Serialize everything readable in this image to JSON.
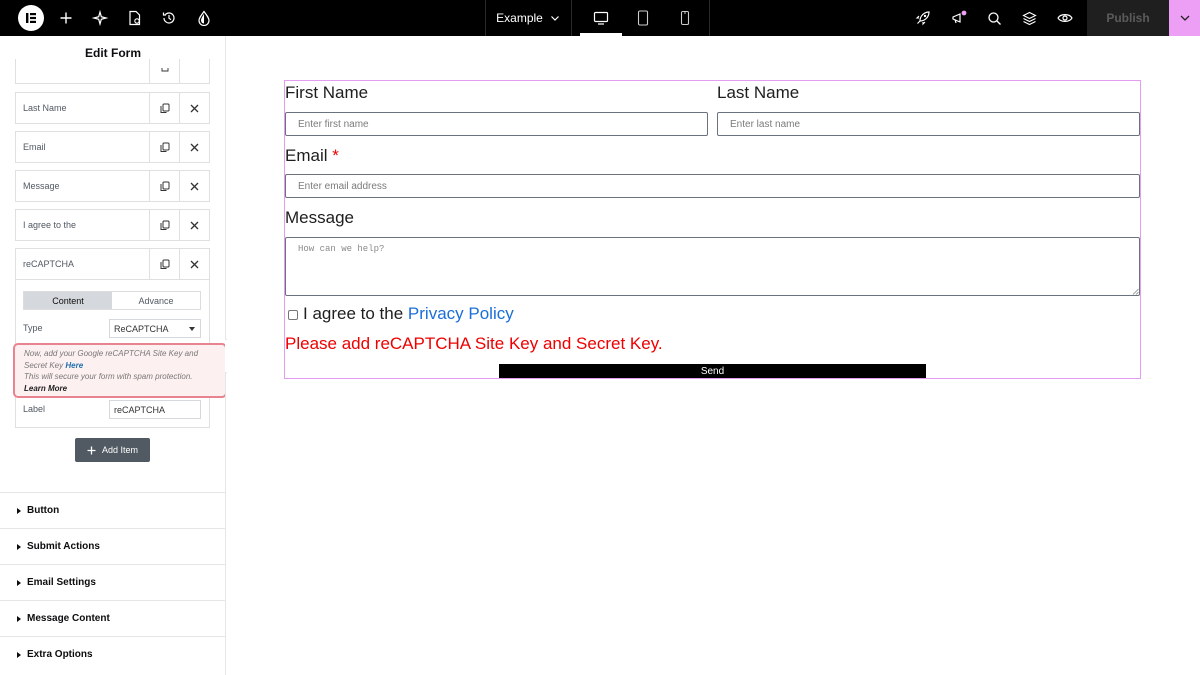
{
  "topbar": {
    "site_name": "Example",
    "publish_label": "Publish",
    "left_icons": [
      "elementor-logo-icon",
      "plus-icon",
      "sparkle-icon",
      "page-settings-icon",
      "history-icon",
      "theme-drop-icon"
    ],
    "right_icons": [
      "rocket-icon",
      "megaphone-icon",
      "search-icon",
      "layers-icon",
      "eye-icon"
    ],
    "devices": [
      "desktop-icon",
      "tablet-icon",
      "mobile-icon"
    ],
    "active_device": "desktop"
  },
  "panel": {
    "title": "Edit Form",
    "items": [
      {
        "label": "Last Name"
      },
      {
        "label": "Email"
      },
      {
        "label": "Message"
      },
      {
        "label": "I agree to the"
      },
      {
        "label": "reCAPTCHA"
      }
    ],
    "tabs": [
      {
        "label": "Content",
        "active": true
      },
      {
        "label": "Advance",
        "active": false
      }
    ],
    "type_label": "Type",
    "type_value": "ReCAPTCHA",
    "notice": {
      "line1": "Now, add your Google reCAPTCHA Site Key and Secret Key",
      "link": "Here",
      "line2": "This will secure your form with spam protection.",
      "learn_more": "Learn More"
    },
    "label_label": "Label",
    "label_value": "reCAPTCHA",
    "add_item": "Add Item",
    "sections": [
      "Button",
      "Submit Actions",
      "Email Settings",
      "Message Content",
      "Extra Options"
    ]
  },
  "form": {
    "first_name_label": "First Name",
    "first_name_placeholder": "Enter first name",
    "last_name_label": "Last Name",
    "last_name_placeholder": "Enter last name",
    "email_label": "Email",
    "email_required": "*",
    "email_placeholder": "Enter email address",
    "message_label": "Message",
    "message_placeholder": "How can we help?",
    "agree_text": "I agree to the",
    "privacy_link": "Privacy Policy",
    "recaptcha_message": "Please add reCAPTCHA Site Key and Secret Key.",
    "send_label": "Send"
  },
  "colors": {
    "accent_pink": "#ec9ff5",
    "form_border": "#e39cf0",
    "error_red": "#e00000",
    "link_blue": "#1a6ed8",
    "notice_border": "#e7848f"
  }
}
